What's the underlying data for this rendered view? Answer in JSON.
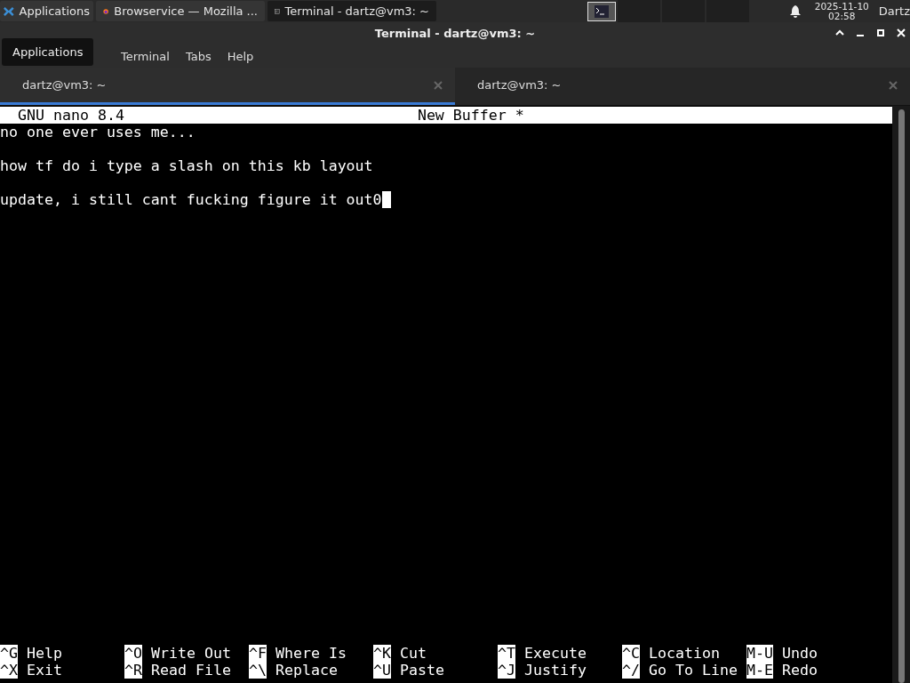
{
  "taskbar": {
    "apps_button": "Applications",
    "tasks": [
      {
        "label": "Browservice — Mozilla ...",
        "kind": "browser",
        "selected": false
      },
      {
        "label": "Terminal - dartz@vm3: ~",
        "kind": "terminal",
        "selected": true
      }
    ],
    "clock": {
      "date": "2025-11-10",
      "time": "02:58"
    },
    "user": "Dartz"
  },
  "tooltip": "Applications",
  "window": {
    "title": "Terminal - dartz@vm3: ~"
  },
  "menu": [
    "Terminal",
    "Tabs",
    "Help"
  ],
  "tabs": [
    {
      "label": "dartz@vm3: ~",
      "selected": true
    },
    {
      "label": "dartz@vm3: ~",
      "selected": false
    }
  ],
  "nano": {
    "version": "GNU nano 8.4",
    "buffer": "New Buffer *",
    "lines": [
      "no one ever uses me...",
      "how tf do i type a slash on this kb layout",
      "update, i still cant fucking figure it out0"
    ],
    "shortcuts": [
      {
        "key": "^G",
        "label": "Help"
      },
      {
        "key": "^O",
        "label": "Write Out"
      },
      {
        "key": "^F",
        "label": "Where Is"
      },
      {
        "key": "^K",
        "label": "Cut"
      },
      {
        "key": "^T",
        "label": "Execute"
      },
      {
        "key": "^C",
        "label": "Location"
      },
      {
        "key": "M-U",
        "label": "Undo"
      },
      {
        "key": "^X",
        "label": "Exit"
      },
      {
        "key": "^R",
        "label": "Read File"
      },
      {
        "key": "^\\",
        "label": "Replace"
      },
      {
        "key": "^U",
        "label": "Paste"
      },
      {
        "key": "^J",
        "label": "Justify"
      },
      {
        "key": "^/",
        "label": "Go To Line"
      },
      {
        "key": "M-E",
        "label": "Redo"
      }
    ]
  }
}
